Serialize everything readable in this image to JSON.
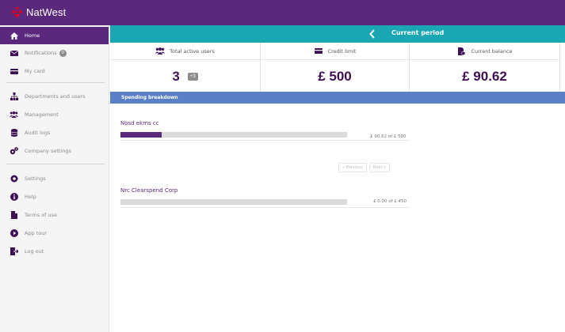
{
  "brand": {
    "name": "NatWest",
    "logo_color": "#e0001b"
  },
  "sidebar": {
    "items": [
      {
        "label": "Home",
        "icon": "home-icon",
        "active": true
      },
      {
        "label": "Notifications",
        "icon": "mail-icon",
        "badge": "0"
      },
      {
        "label": "My card",
        "icon": "card-icon"
      },
      {
        "label": "Departments and users",
        "icon": "org-chart-icon"
      },
      {
        "label": "Management",
        "icon": "users-icon"
      },
      {
        "label": "Audit logs",
        "icon": "database-icon"
      },
      {
        "label": "Company settings",
        "icon": "cogs-icon"
      },
      {
        "label": "Settings",
        "icon": "gear-icon"
      },
      {
        "label": "Help",
        "icon": "info-icon"
      },
      {
        "label": "Terms of use",
        "icon": "document-icon"
      },
      {
        "label": "App tour",
        "icon": "play-icon"
      },
      {
        "label": "Log out",
        "icon": "logout-icon"
      }
    ]
  },
  "period": {
    "title": "Current period",
    "back_icon": "chevron-left-icon"
  },
  "stats": {
    "active_users": {
      "label": "Total active users",
      "value": "3",
      "extra": "+3",
      "icon": "users-icon"
    },
    "credit_limit": {
      "label": "Credit limit",
      "value": "£ 500",
      "icon": "card-icon"
    },
    "balance": {
      "label": "Current balance",
      "value": "£ 90.62",
      "icon": "balance-icon"
    }
  },
  "breakdown": {
    "title": "Spending breakdown",
    "accounts": [
      {
        "name": "Nosd ekms cc",
        "amount": "£ 90.62 of £ 500",
        "progress": 0.181
      },
      {
        "name": "Nrc Clearspend Corp",
        "amount": "£ 0.00 of £ 450",
        "progress": 0
      }
    ],
    "pager": {
      "previous": "« Previous",
      "next": "Next »"
    }
  },
  "colors": {
    "primary": "#5a287d",
    "teal": "#1aa7b3",
    "section": "#5b80c7"
  }
}
